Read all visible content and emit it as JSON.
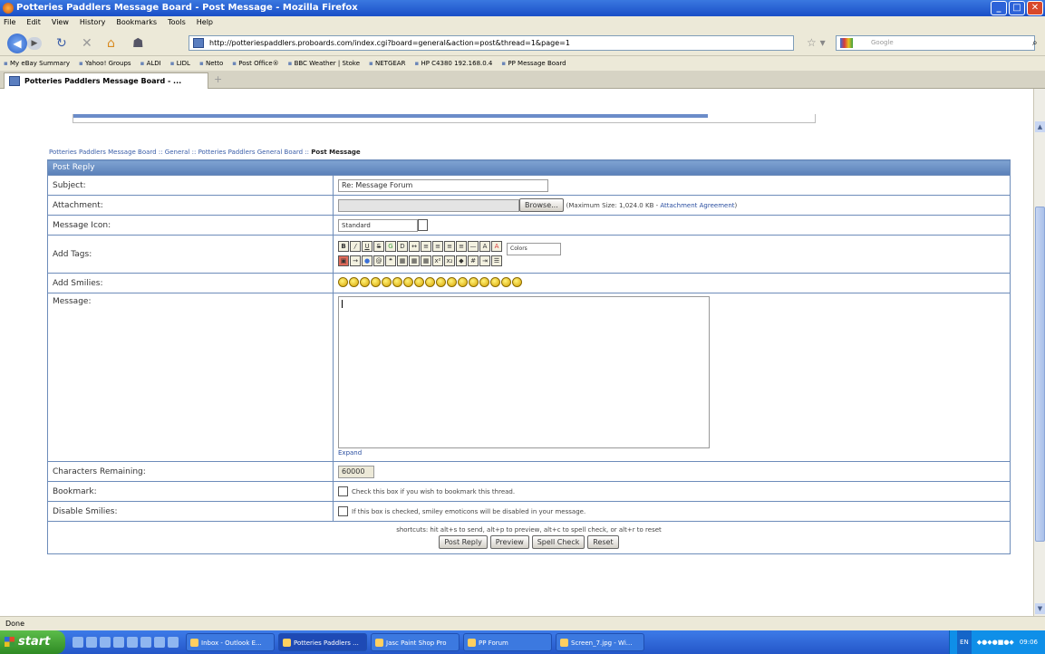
{
  "window": {
    "title": "Potteries Paddlers Message Board - Post Message - Mozilla Firefox"
  },
  "menu": [
    "File",
    "Edit",
    "View",
    "History",
    "Bookmarks",
    "Tools",
    "Help"
  ],
  "address": {
    "url": "http://potteriespaddlers.proboards.com/index.cgi?board=general&action=post&thread=1&page=1"
  },
  "search": {
    "placeholder": "Google"
  },
  "bookmarks": [
    "My eBay Summary",
    "Yahoo! Groups",
    "ALDI",
    "LIDL",
    "Netto",
    "Post Office®",
    "BBC Weather | Stoke",
    "NETGEAR",
    "HP C4380 192.168.0.4",
    "PP Message Board"
  ],
  "tab": {
    "title": "Potteries Paddlers Message Board - ..."
  },
  "breadcrumb": {
    "board": "Potteries Paddlers Message Board",
    "sep": " :: ",
    "general": "General",
    "forum": "Potteries Paddlers General Board",
    "current": "Post Message"
  },
  "form": {
    "header": "Post Reply",
    "subject_label": "Subject:",
    "subject_value": "Re: Message Forum",
    "attachment_label": "Attachment:",
    "browse_label": "Browse...",
    "attachment_note": "(Maximum Size: 1,024.0 KB - ",
    "attachment_link": "Attachment Agreement",
    "attachment_close": ")",
    "icon_label": "Message Icon:",
    "icon_value": "Standard",
    "tags_label": "Add Tags:",
    "colors_value": "Colors",
    "smilies_label": "Add Smilies:",
    "message_label": "Message:",
    "expand_label": "Expand",
    "chars_label": "Characters Remaining:",
    "chars_value": "60000",
    "bookmark_label": "Bookmark:",
    "bookmark_note": "Check this box if you wish to bookmark this thread.",
    "disable_label": "Disable Smilies:",
    "disable_note": "If this box is checked, smiley emoticons will be disabled in your message.",
    "shortcuts": "shortcuts: hit alt+s to send, alt+p to preview, alt+c to spell check, or alt+r to reset",
    "post_btn": "Post Reply",
    "preview_btn": "Preview",
    "spell_btn": "Spell Check",
    "reset_btn": "Reset"
  },
  "status": {
    "text": "Done"
  },
  "taskbar": {
    "start": "start",
    "tasks": [
      "Inbox - Outlook E...",
      "Potteries Paddlers ...",
      "Jasc Paint Shop Pro",
      "PP Forum",
      "Screen_7.jpg - Wi..."
    ],
    "lang": "EN",
    "clock": "09:06"
  }
}
